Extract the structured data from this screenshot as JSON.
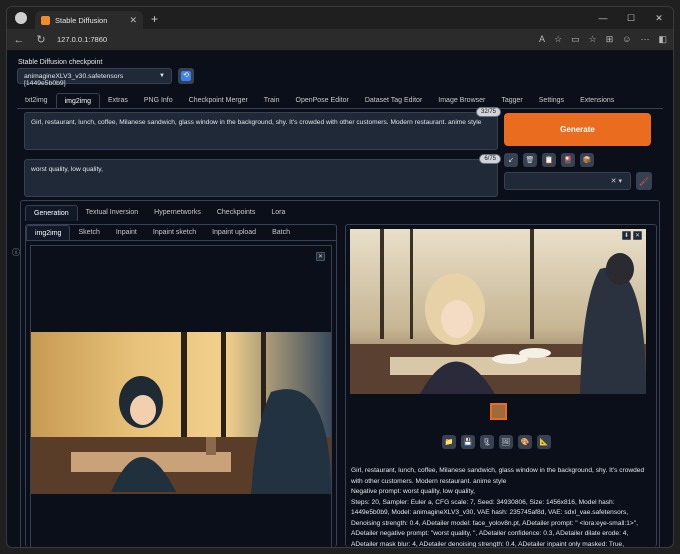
{
  "browser": {
    "tab_title": "Stable Diffusion",
    "tab_close": "✕",
    "new_tab": "+",
    "url": "127.0.0.1:7860",
    "window_controls": [
      "—",
      "☐",
      "✕"
    ],
    "nav": [
      "←",
      "↻"
    ],
    "tool_icons": [
      "A",
      "☆",
      "▭",
      "☆",
      "⊞",
      "☺",
      "⋯",
      "◧"
    ]
  },
  "checkpoint": {
    "label": "Stable Diffusion checkpoint",
    "value": "animagineXLV3_v30.safetensors [1449e5b0b9]",
    "arrow": "▼",
    "refresh_icon": "⟲"
  },
  "main_tabs": [
    "txt2img",
    "img2img",
    "Extras",
    "PNG Info",
    "Checkpoint Merger",
    "Train",
    "OpenPose Editor",
    "Dataset Tag Editor",
    "Image Browser",
    "Tagger",
    "Settings",
    "Extensions"
  ],
  "prompt": {
    "positive": "Girl, restaurant, lunch, coffee, Milanese sandwich, glass window in the background, shy. It's crowded with other customers. Modern restaurant. anime style",
    "positive_tokens": "32/75",
    "negative": "worst quality, low quality,",
    "negative_tokens": "6/75"
  },
  "generate_label": "Generate",
  "tool_buttons": [
    "↙",
    "🗑",
    "📋",
    "🎴",
    "📦"
  ],
  "style_select_icon": "✕ ▾",
  "style_apply_icon": "🖌",
  "sub_tabs": [
    "Generation",
    "Textual Inversion",
    "Hypernetworks",
    "Checkpoints",
    "Lora"
  ],
  "img_tabs": [
    "img2img",
    "Sketch",
    "Inpaint",
    "Inpaint sketch",
    "Inpaint upload",
    "Batch"
  ],
  "close_icon": "✕",
  "download_icon": "⬇",
  "action_buttons": [
    "📁",
    "💾",
    "🗜",
    "🖼",
    "🎨",
    "📐"
  ],
  "output_info": {
    "prompt": "Girl, restaurant, lunch, coffee, Milanese sandwich, glass window in the background, shy. It's crowded with other customers. Modern restaurant. anime style",
    "negative": "Negative prompt: worst quality, low quality,",
    "params": "Steps: 20, Sampler: Euler a, CFG scale: 7, Seed: 34930806, Size: 1456x816, Model hash: 1449e5b0b9, Model: animagineXLV3_v30, VAE hash: 235745af8d, VAE: sdxl_vae.safetensors, Denoising strength: 0.4, ADetailer model: face_yolov8n.pt, ADetailer prompt: \" <lora:eye-small:1>\", ADetailer negative prompt: \"worst quality, \", ADetailer confidence: 0.3, ADetailer dilate erode: 4, ADetailer mask blur: 4, ADetailer denoising strength: 0.4, ADetailer inpaint only masked: True, ADetailer inpaint padding: 32, ADetailer version: 24.1.2, Mask blur: 4"
  },
  "colors": {
    "accent": "#ea6c1e",
    "bg": "#0b0f19",
    "panel": "#1f2937",
    "border": "#374151"
  }
}
